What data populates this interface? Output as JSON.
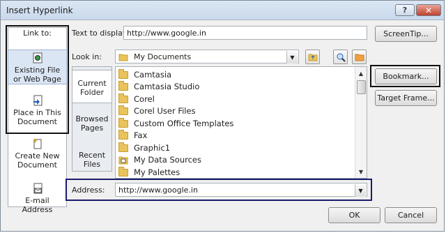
{
  "window": {
    "title": "Insert Hyperlink",
    "help_label": "?",
    "close_label": "✕"
  },
  "link_to": {
    "header": "Link to:",
    "items": [
      {
        "line1": "Existing File",
        "line2": "or Web Page",
        "icon": "web-page-icon"
      },
      {
        "line1": "Place in This",
        "line2": "Document",
        "icon": "document-place-icon"
      },
      {
        "line1": "Create New",
        "line2": "Document",
        "icon": "new-document-icon"
      },
      {
        "line1": "E-mail",
        "line2": "Address",
        "icon": "email-icon"
      }
    ]
  },
  "text_to_display": {
    "label": "Text to display:",
    "value": "http://www.google.in"
  },
  "screentip_button": "ScreenTip...",
  "look_in": {
    "label": "Look in:",
    "value": "My Documents"
  },
  "sidebar2": [
    {
      "line1": "Current",
      "line2": "Folder"
    },
    {
      "line1": "Browsed",
      "line2": "Pages"
    },
    {
      "line1": "Recent",
      "line2": "Files"
    }
  ],
  "files": [
    "Camtasia",
    "Camtasia Studio",
    "Corel",
    "Corel User Files",
    "Custom Office Templates",
    "Fax",
    "Graphic1",
    "My Data Sources",
    "My Palettes"
  ],
  "bookmark_button": "Bookmark...",
  "target_frame_button": "Target Frame...",
  "address": {
    "label": "Address:",
    "value": "http://www.google.in"
  },
  "ok_button": "OK",
  "cancel_button": "Cancel"
}
